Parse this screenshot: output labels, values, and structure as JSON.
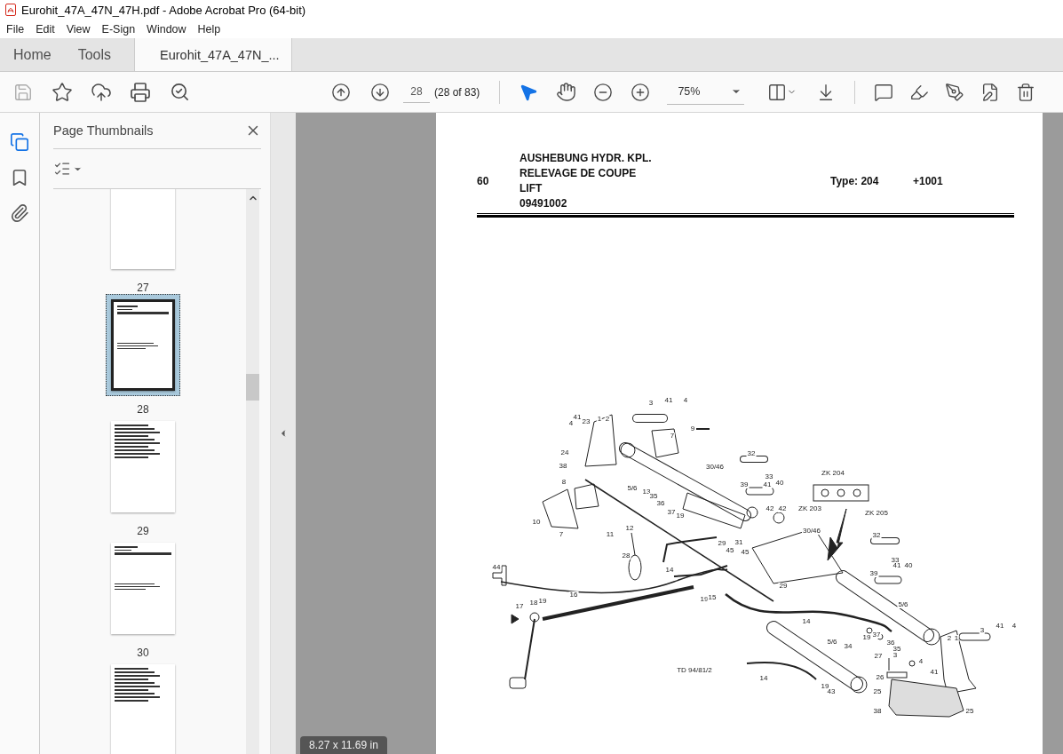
{
  "window": {
    "title": "Eurohit_47A_47N_47H.pdf - Adobe Acrobat Pro (64-bit)"
  },
  "menu": [
    "File",
    "Edit",
    "View",
    "E-Sign",
    "Window",
    "Help"
  ],
  "tabs": [
    {
      "label": "Home",
      "kind": "nav",
      "selected": false
    },
    {
      "label": "Tools",
      "kind": "nav",
      "selected": false
    },
    {
      "label": "Eurohit_47A_47N_...",
      "kind": "document",
      "selected": true
    }
  ],
  "toolbar": {
    "page_number": "28",
    "page_count": "(28 of 83)",
    "zoom": "75%"
  },
  "left_rail": [
    {
      "kind": "pages",
      "selected": true
    },
    {
      "kind": "bookmarks",
      "selected": false
    },
    {
      "kind": "attachments",
      "selected": false
    }
  ],
  "thumbnails_panel": {
    "title": "Page Thumbnails",
    "pages": [
      {
        "label": "27",
        "kind": "text",
        "selected": false
      },
      {
        "label": "28",
        "kind": "drawing",
        "selected": true
      },
      {
        "label": "29",
        "kind": "list",
        "selected": false
      },
      {
        "label": "30",
        "kind": "drawing",
        "selected": false
      },
      {
        "kind": "list",
        "selected": false
      }
    ]
  },
  "document": {
    "page_size": "8.27 x 11.69 in",
    "header": {
      "section": "60",
      "titles": [
        "AUSHEBUNG HYDR. KPL.",
        "RELEVAGE DE COUPE",
        "LIFT",
        "09491002"
      ],
      "type": "Type: 204",
      "serial": "+1001"
    },
    "drawing_id": "TD 94/81/2",
    "callouts": [
      "3",
      "41",
      "4",
      "9",
      "7",
      "41",
      "4",
      "23",
      "1",
      "2",
      "24",
      "38",
      "8",
      "10",
      "7",
      "11",
      "12",
      "5/6",
      "13",
      "35",
      "36",
      "37",
      "19",
      "30/46",
      "32",
      "39",
      "33",
      "41",
      "40",
      "42",
      "42",
      "29",
      "45",
      "31",
      "45",
      "30/46",
      "ZK 204",
      "ZK 203",
      "ZK 205",
      "32",
      "33",
      "41",
      "40",
      "39",
      "29",
      "5/6",
      "28",
      "14",
      "44",
      "16",
      "17",
      "18",
      "19",
      "19",
      "15",
      "14",
      "19",
      "37",
      "36",
      "35",
      "3",
      "5/6",
      "34",
      "27",
      "2",
      "1",
      "3",
      "41",
      "4",
      "4",
      "41",
      "26",
      "25",
      "14",
      "19",
      "43",
      "38",
      "25"
    ]
  }
}
